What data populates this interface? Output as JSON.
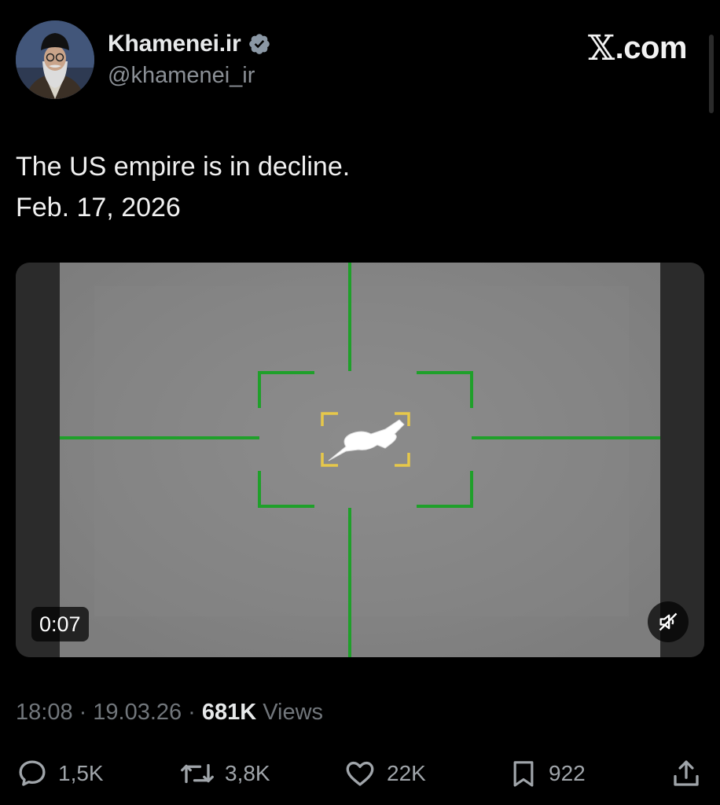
{
  "author": {
    "display_name": "Khamenei.ir",
    "handle": "@khamenei_ir",
    "verified": true
  },
  "brand": {
    "x_glyph": "𝕏",
    "suffix": ".com"
  },
  "tweet": {
    "line1": "The US empire is in decline.",
    "line2": "Feb. 17, 2026"
  },
  "media": {
    "duration": "0:07",
    "muted": true
  },
  "meta": {
    "time": "18:08",
    "sep1": "·",
    "date": "19.03.26",
    "sep2": "·",
    "views_count": "681K",
    "views_label": "Views"
  },
  "actions": {
    "reply_count": "1,5K",
    "repost_count": "3,8K",
    "like_count": "22K",
    "bookmark_count": "922"
  },
  "colors": {
    "background": "#000000",
    "text": "#e7e9ea",
    "muted": "#71767b",
    "verified": "#8b98a5",
    "reticle_green": "#1fa02a",
    "target_yellow": "#e6c84a"
  }
}
